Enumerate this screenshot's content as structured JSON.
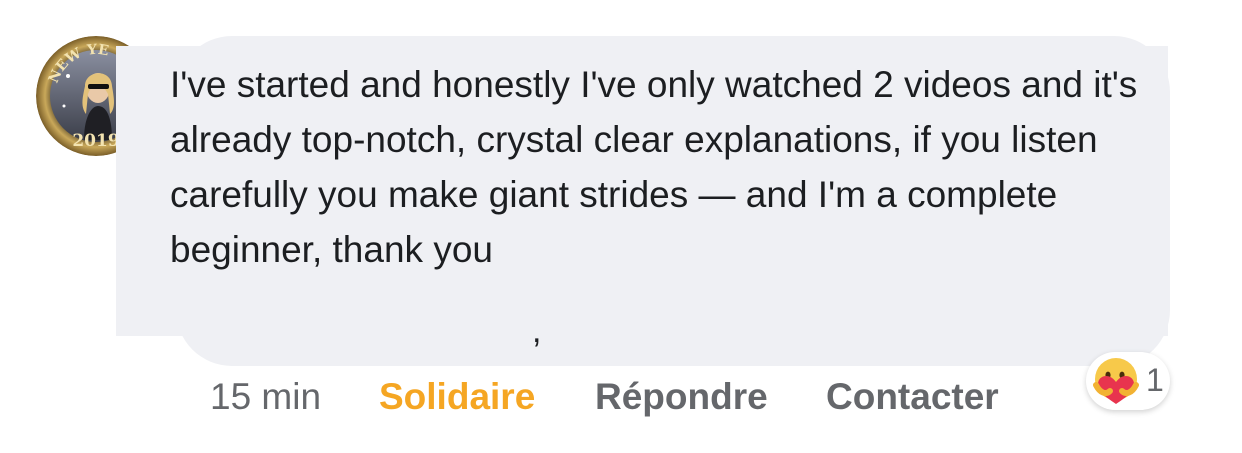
{
  "comment": {
    "text": "I've started and honestly I've only watched 2 videos and it's already top-notch, crystal clear explanations, if you listen carefully you make giant strides — and I'm a complete beginner, thank you",
    "stray_mark": ","
  },
  "avatar": {
    "frame_text_top": "NEW YE",
    "frame_text_bottom": "2019"
  },
  "actions": {
    "timestamp": "15 min",
    "solidaire_label": "Solidaire",
    "reply_label": "Répondre",
    "contact_label": "Contacter"
  },
  "reaction": {
    "icon": "care-emoji-icon",
    "count": "1"
  },
  "colors": {
    "bubble": "#eff0f4",
    "text": "#1c1e21",
    "muted": "#65676b",
    "accent": "#f5a623"
  }
}
